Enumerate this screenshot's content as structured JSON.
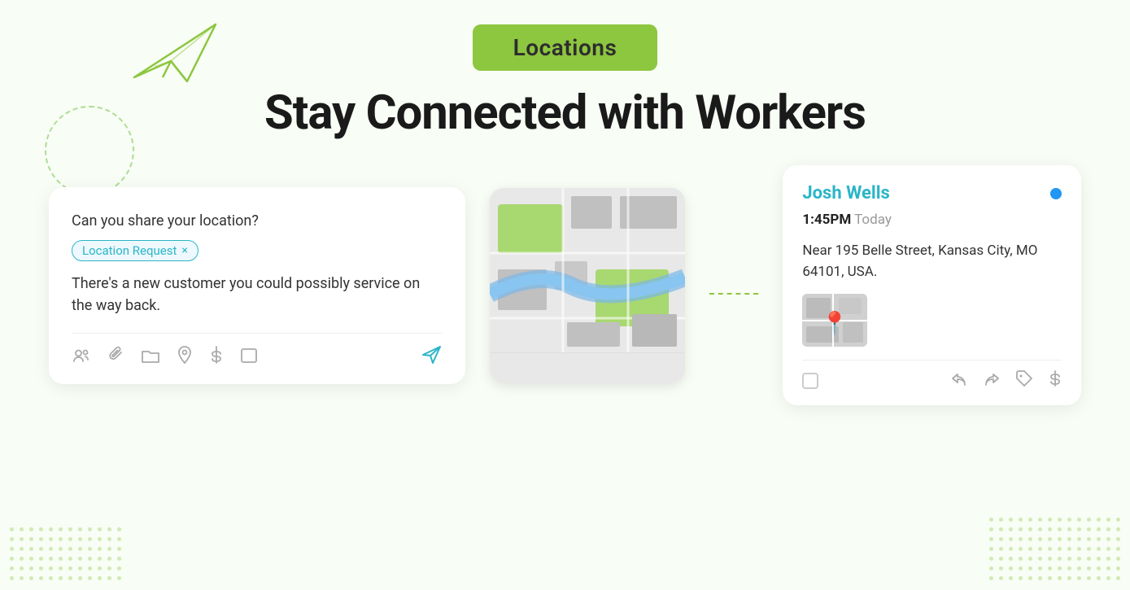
{
  "page": {
    "background_color": "#f8fdf5"
  },
  "header": {
    "badge_label": "Locations",
    "badge_bg": "#8dc63f",
    "main_heading": "Stay Connected with Workers"
  },
  "chat_card": {
    "message_line1": "Can you share your location?",
    "location_tag_label": "Location Request",
    "location_tag_close": "×",
    "message_line2": "There's a new customer you could possibly service on the way back.",
    "toolbar_icons": [
      "assign-icon",
      "attach-icon",
      "folder-icon",
      "location-icon",
      "dollar-icon",
      "bracket-icon"
    ],
    "send_icon_label": "send"
  },
  "map_card": {
    "alt": "Map showing location"
  },
  "worker_card": {
    "name": "Josh Wells",
    "online_status": "online",
    "time": "1:45PM",
    "time_suffix": "Today",
    "address": "Near 195 Belle Street, Kansas City, MO 64101, USA.",
    "toolbar_icons": [
      "reply-icon",
      "forward-icon",
      "tag-icon",
      "dollar-icon"
    ],
    "checkbox_label": "select"
  }
}
